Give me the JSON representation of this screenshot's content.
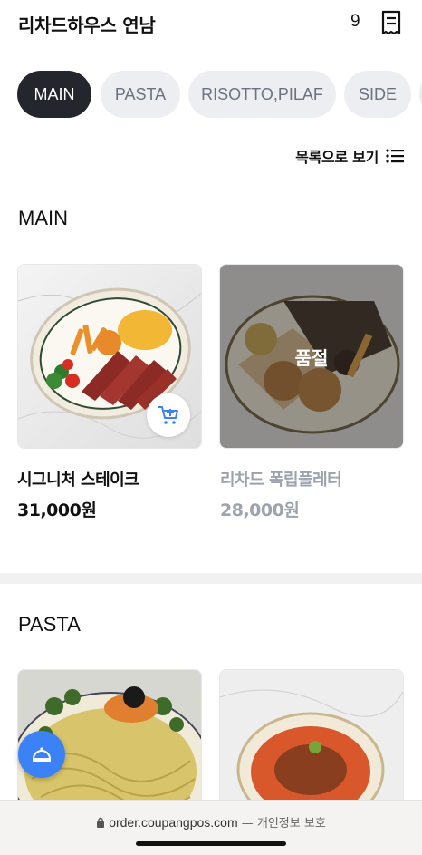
{
  "header": {
    "store_name": "리차드하우스 연남",
    "cart_count": "9",
    "receipt_icon": "receipt-icon"
  },
  "tabs": [
    {
      "label": "MAIN",
      "active": true
    },
    {
      "label": "PASTA",
      "active": false
    },
    {
      "label": "RISOTTO,PILAF",
      "active": false
    },
    {
      "label": "SIDE",
      "active": false
    }
  ],
  "list_toggle": {
    "label": "목록으로 보기",
    "icon": "list-icon"
  },
  "sections": [
    {
      "title": "MAIN",
      "items": [
        {
          "name": "시그니처 스테이크",
          "price": "31,000원",
          "sold_out": false,
          "add_icon": "add-cart-icon"
        },
        {
          "name": "리차드 폭립플레터",
          "price": "28,000원",
          "sold_out": true,
          "sold_out_label": "품절"
        }
      ]
    },
    {
      "title": "PASTA",
      "items": [
        {
          "name": "",
          "price": ""
        },
        {
          "name": "",
          "price": ""
        }
      ]
    }
  ],
  "fab": {
    "icon": "cloche-icon"
  },
  "browser": {
    "url": "order.coupangpos.com",
    "privacy": " — 개인정보 보호",
    "lock_icon": "lock-icon"
  },
  "colors": {
    "active_tab": "#23272d",
    "inactive_tab": "#eceef1",
    "fab": "#3b82f6",
    "add_cart_icon": "#3b82f6"
  }
}
